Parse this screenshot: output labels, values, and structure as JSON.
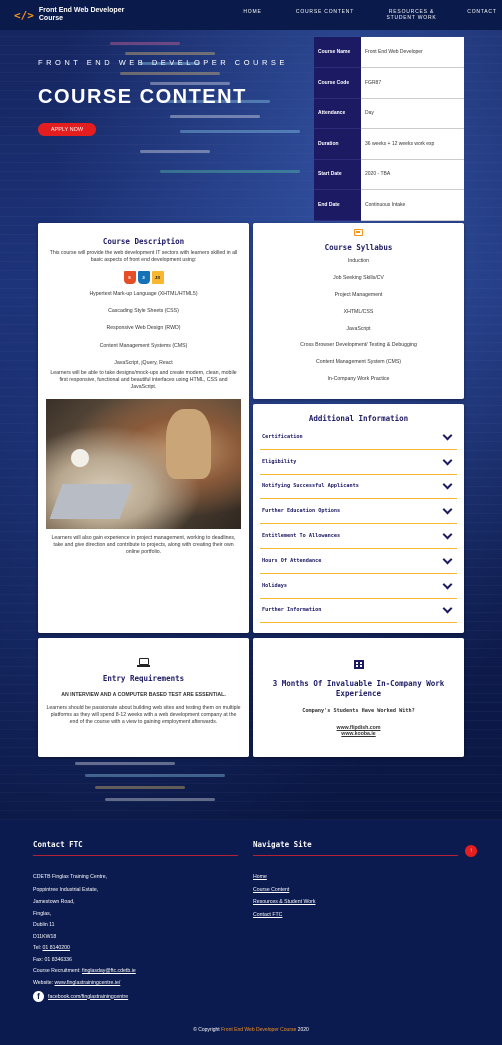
{
  "nav": {
    "brand_line1": "Front End Web Developer",
    "brand_line2": "Course",
    "logo_glyph": "</>",
    "links": [
      "HOME",
      "COURSE CONTENT",
      "RESOURCES &",
      "STUDENT WORK",
      "CONTACT"
    ]
  },
  "hero": {
    "subtitle": "FRONT END WEB DEVELOPER COURSE",
    "title": "COURSE CONTENT",
    "apply_label": "APPLY NOW"
  },
  "info_table": [
    {
      "key": "Course Name",
      "value": "Front End Web Developer"
    },
    {
      "key": "Course Code",
      "value": "FGR87"
    },
    {
      "key": "Attendance",
      "value": "Day"
    },
    {
      "key": "Duration",
      "value": "36 weeks + 12 weeks work exp"
    },
    {
      "key": "Start Date",
      "value": "2020 - TBA"
    },
    {
      "key": "End Date",
      "value": "Continuous Intake"
    }
  ],
  "description": {
    "title": "Course Description",
    "intro": "This course will provide the web development IT sectors with learners skilled in all basic aspects of front end development using:",
    "tech_icons": [
      {
        "name": "html5-icon",
        "label": "5",
        "color": "#e44d26"
      },
      {
        "name": "css3-icon",
        "label": "3",
        "color": "#1572b6"
      },
      {
        "name": "javascript-icon",
        "label": "JS",
        "color": "#f7b731"
      }
    ],
    "items": [
      "Hypertext Mark-up Language (XHTML/HTML5)",
      "Cascading Style Sheets (CSS)",
      "Responsive Web Design (RWD)",
      "Content Management Systems (CMS)",
      "JavaScript, jQuery, React"
    ],
    "para2": "Learners will be able to take designs/mock-ups and create modern, clean, mobile first responsive, functional and beautiful interfaces using HTML, CSS and JavaScript.",
    "para3": "Learners will also gain experience in project management, working to deadlines, take and give direction and contribute to projects, along with creating their own online portfolio."
  },
  "syllabus": {
    "title": "Course Syllabus",
    "items": [
      "Induction",
      "Job Seeking Skills/CV",
      "Project Management",
      "XHTML/CSS",
      "JavaScript",
      "Cross Browser Development/ Testing & Debugging",
      "Content Management System (CMS)",
      "In-Company Work Practice"
    ]
  },
  "additional": {
    "title": "Additional Information",
    "items": [
      "Certification",
      "Eligibility",
      "Notifying Successful Applicants",
      "Further Education Options",
      "Entitlement To Allowances",
      "Hours Of Attendance",
      "Holidays",
      "Further Information"
    ]
  },
  "entry": {
    "title": "Entry Requirements",
    "bold": "AN INTERVIEW AND A COMPUTER BASED TEST ARE ESSENTIAL.",
    "para": "Learners should be passionate about building web sites and testing them on multiple platforms as they will spend 8-12 weeks with a web development company at the end of the course with a view to gaining employment afterwards."
  },
  "work": {
    "title": "3 Months Of Invaluable In-Company Work Experience",
    "subtitle": "Company's Students Have Worked With?",
    "links": [
      "www.flipdish.com",
      "www.kooba.ie"
    ]
  },
  "footer": {
    "contact_title": "Contact FTC",
    "navigate_title": "Navigate Site",
    "address": [
      "CDETB Finglas Training Centre,",
      "Poppintree Industrial Estate,",
      "Jamestown Road,",
      "Finglas,",
      "Dublin 11",
      "D11KW18"
    ],
    "tel_label": "Tel: ",
    "tel": "01 8140200",
    "fax": "Fax: 01 8346336",
    "recruit_label": "Course Recruitment: ",
    "recruit_email": "finglasday@ftc.cdetb.ie",
    "website_label": "Website: ",
    "website": "www.finglastrainingcentre.ie/",
    "facebook": "facebook.com/finglastrainingcentre",
    "nav_links": [
      "Home",
      "Course Content",
      "Resources & Student Work",
      "Contact FTC"
    ],
    "top_glyph": "↑",
    "copyright_prefix": "© Copyright ",
    "copyright_brand": "Front End Web Developer Course",
    "copyright_year": " 2020"
  }
}
